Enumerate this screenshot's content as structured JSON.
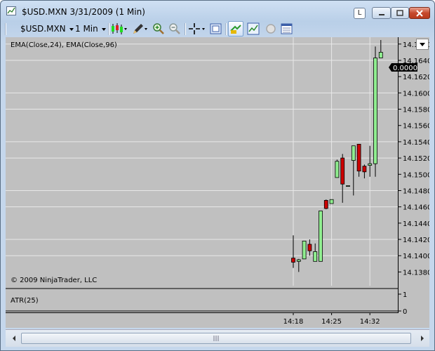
{
  "window": {
    "title": "$USD.MXN  3/31/2009 (1 Min)",
    "title_buttons": {
      "l_label": "L"
    }
  },
  "toolbar": {
    "instrument": "$USD.MXN",
    "interval": "1 Min",
    "icons": [
      "candlestick-style-icon",
      "drawing-pencil-icon",
      "zoom-in-icon",
      "zoom-out-icon",
      "crosshair-icon",
      "data-box-icon",
      "chart-properties-icon",
      "indicators-icon",
      "strategies-icon",
      "chart-trader-icon"
    ]
  },
  "chart": {
    "indicator_label": "EMA(Close,24), EMA(Close,96)",
    "copyright": "© 2009 NinjaTrader, LLC",
    "atr_label": "ATR(25)",
    "price_axis_labels": [
      "14.1660",
      "14.1640",
      "14.1620",
      "14.1600",
      "14.1580",
      "14.1560",
      "14.1540",
      "14.1520",
      "14.1500",
      "14.1480",
      "14.1460",
      "14.1440",
      "14.1420",
      "14.1400",
      "14.1380"
    ],
    "atr_axis_labels": [
      "1",
      "0"
    ],
    "time_labels": [
      "14:18",
      "14:25",
      "14:32"
    ],
    "current_value_badge": "0.0000",
    "colors": {
      "background": "#c0c0c0",
      "up_candle": "#90ee90",
      "down_candle": "#cc0000",
      "grid": "#e8e8e8"
    }
  },
  "chart_data": {
    "type": "candlestick",
    "y_range": [
      14.137,
      14.1665
    ],
    "candles": [
      {
        "time": "14:18",
        "open": 14.1397,
        "high": 14.1425,
        "low": 14.1385,
        "close": 14.1392
      },
      {
        "time": "14:19",
        "open": 14.1393,
        "high": 14.1396,
        "low": 14.138,
        "close": 14.1395
      },
      {
        "time": "14:20",
        "open": 14.1396,
        "high": 14.1418,
        "low": 14.1396,
        "close": 14.1418
      },
      {
        "time": "14:21",
        "open": 14.1414,
        "high": 14.142,
        "low": 14.14,
        "close": 14.1406
      },
      {
        "time": "14:22",
        "open": 14.1393,
        "high": 14.1415,
        "low": 14.1393,
        "close": 14.1405
      },
      {
        "time": "14:23",
        "open": 14.1393,
        "high": 14.1455,
        "low": 14.1393,
        "close": 14.1455
      },
      {
        "time": "14:24",
        "open": 14.1468,
        "high": 14.1469,
        "low": 14.1457,
        "close": 14.1458
      },
      {
        "time": "14:25",
        "open": 14.1464,
        "high": 14.1469,
        "low": 14.1464,
        "close": 14.1469
      },
      {
        "time": "14:26",
        "open": 14.1496,
        "high": 14.1518,
        "low": 14.1496,
        "close": 14.1516
      },
      {
        "time": "14:27",
        "open": 14.152,
        "high": 14.1525,
        "low": 14.1465,
        "close": 14.1488
      },
      {
        "time": "14:28",
        "open": 14.1486,
        "high": 14.1486,
        "low": 14.1486,
        "close": 14.1486
      },
      {
        "time": "14:29",
        "open": 14.1517,
        "high": 14.1535,
        "low": 14.1474,
        "close": 14.1535
      },
      {
        "time": "14:30",
        "open": 14.1537,
        "high": 14.1537,
        "low": 14.1497,
        "close": 14.1504
      },
      {
        "time": "14:31",
        "open": 14.151,
        "high": 14.1512,
        "low": 14.1495,
        "close": 14.1503
      },
      {
        "time": "14:32",
        "open": 14.1511,
        "high": 14.1535,
        "low": 14.1497,
        "close": 14.1513
      },
      {
        "time": "14:33",
        "open": 14.1513,
        "high": 14.1657,
        "low": 14.1497,
        "close": 14.1643
      },
      {
        "time": "14:34",
        "open": 14.1643,
        "high": 14.1665,
        "low": 14.1643,
        "close": 14.165
      }
    ]
  }
}
